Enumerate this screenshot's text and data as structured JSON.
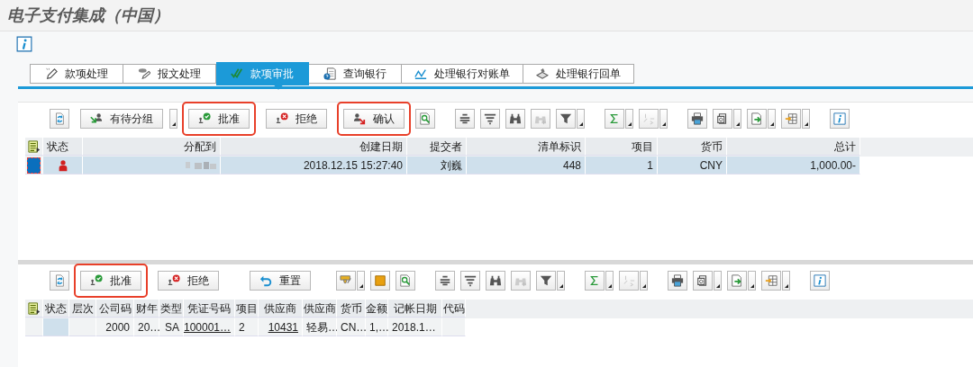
{
  "title": "电子支付集成（中国）",
  "tabs": [
    {
      "label": "款项处理",
      "selected": false,
      "kind": "pen"
    },
    {
      "label": "报文处理",
      "selected": false,
      "kind": "stamp"
    },
    {
      "label": "款项审批",
      "selected": true,
      "kind": "check"
    },
    {
      "label": "查询银行",
      "selected": false,
      "kind": "query"
    },
    {
      "label": "处理银行对账单",
      "selected": false,
      "kind": "statement"
    },
    {
      "label": "处理银行回单",
      "selected": false,
      "kind": "receipt"
    }
  ],
  "upper": {
    "buttons": [
      {
        "kind": "group",
        "label": "有待分组",
        "highlighted": false
      },
      {
        "kind": "approve",
        "label": "批准",
        "highlighted": true
      },
      {
        "kind": "reject",
        "label": "拒绝",
        "highlighted": false
      },
      {
        "kind": "confirm",
        "label": "确认",
        "highlighted": true
      }
    ],
    "columns": [
      "状态",
      "分配到",
      "创建日期",
      "提交者",
      "清单标识",
      "项目",
      "货币",
      "总计"
    ],
    "rows": [
      {
        "selected": true,
        "cells": [
          "",
          "",
          "2018.12.15 15:27:40",
          "刘巍",
          "448",
          "1",
          "CNY",
          "1,000.00-"
        ]
      }
    ]
  },
  "lower": {
    "buttons": [
      {
        "kind": "approve",
        "label": "批准",
        "highlighted": true
      },
      {
        "kind": "reject",
        "label": "拒绝",
        "highlighted": false
      },
      {
        "kind": "reset",
        "label": "重置",
        "highlighted": false
      }
    ],
    "columns": [
      "状态",
      "层次",
      "公司码",
      "财年",
      "类型",
      "凭证号码",
      "项目",
      "供应商",
      "供应商",
      "货币",
      "金额",
      "记帐日期",
      "代码"
    ],
    "rows": [
      {
        "cells": [
          {
            "text": ""
          },
          {
            "text": ""
          },
          {
            "text": "2000",
            "link": false
          },
          {
            "text": "20…",
            "link": false
          },
          {
            "text": "SA",
            "link": false
          },
          {
            "text": "100001…",
            "link": true
          },
          {
            "text": "2",
            "link": false
          },
          {
            "text": "10431",
            "link": true
          },
          {
            "text": "轻易…",
            "link": false
          },
          {
            "text": "CN…",
            "link": false
          },
          {
            "text": "1,…",
            "link": false
          },
          {
            "text": "2018.1…",
            "link": false
          },
          {
            "text": ""
          }
        ]
      }
    ]
  }
}
